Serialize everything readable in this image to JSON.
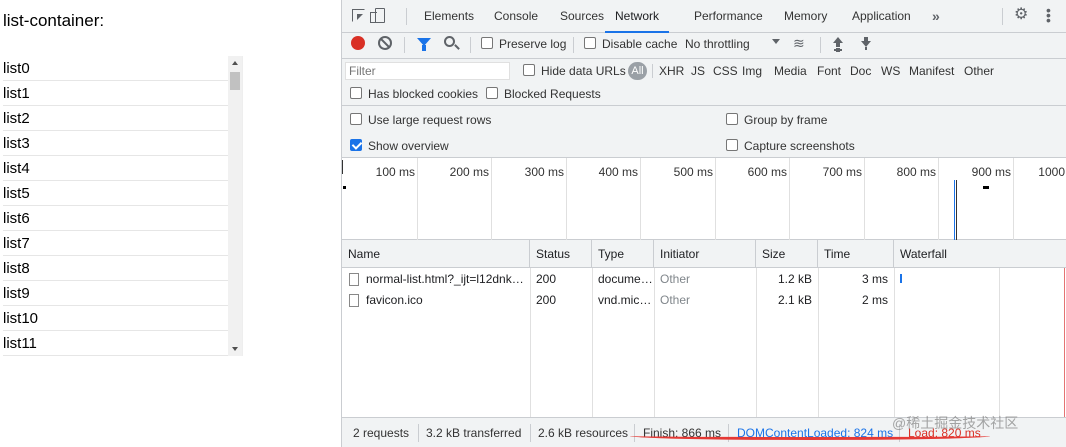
{
  "page": {
    "title": "list-container:",
    "items": [
      "list0",
      "list1",
      "list2",
      "list3",
      "list4",
      "list5",
      "list6",
      "list7",
      "list8",
      "list9",
      "list10",
      "list11"
    ]
  },
  "devtools": {
    "tabs": [
      "Elements",
      "Console",
      "Sources",
      "Network",
      "Performance",
      "Memory",
      "Application"
    ],
    "active_tab": "Network",
    "more_tabs_glyph": "»",
    "toolbar": {
      "preserve_log": "Preserve log",
      "disable_cache": "Disable cache",
      "throttling": "No throttling"
    },
    "filter": {
      "placeholder": "Filter",
      "hide_data_urls": "Hide data URLs",
      "all": "All",
      "types": [
        "XHR",
        "JS",
        "CSS",
        "Img",
        "Media",
        "Font",
        "Doc",
        "WS",
        "Manifest",
        "Other"
      ],
      "has_blocked_cookies": "Has blocked cookies",
      "blocked_requests": "Blocked Requests"
    },
    "settings": {
      "large_rows": "Use large request rows",
      "show_overview": "Show overview",
      "group_by_frame": "Group by frame",
      "capture_screenshots": "Capture screenshots"
    },
    "overview_ticks": [
      "100 ms",
      "200 ms",
      "300 ms",
      "400 ms",
      "500 ms",
      "600 ms",
      "700 ms",
      "800 ms",
      "900 ms",
      "1000"
    ],
    "columns": [
      "Name",
      "Status",
      "Type",
      "Initiator",
      "Size",
      "Time",
      "Waterfall"
    ],
    "rows": [
      {
        "name": "normal-list.html?_ijt=l12dnk…",
        "status": "200",
        "type": "docume…",
        "initiator": "Other",
        "size": "1.2 kB",
        "time": "3 ms"
      },
      {
        "name": "favicon.ico",
        "status": "200",
        "type": "vnd.mic…",
        "initiator": "Other",
        "size": "2.1 kB",
        "time": "2 ms"
      }
    ],
    "status": {
      "requests": "2 requests",
      "transferred": "3.2 kB transferred",
      "resources": "2.6 kB resources",
      "finish": "Finish: 866 ms",
      "dom_content_loaded": "DOMContentLoaded: 824 ms",
      "load": "Load: 820 ms"
    },
    "colors": {
      "accent": "#1a73e8",
      "record": "#d93025",
      "dcl": "#1a73e8",
      "load": "#d93025"
    }
  },
  "watermark": "@稀土掘金技术社区"
}
